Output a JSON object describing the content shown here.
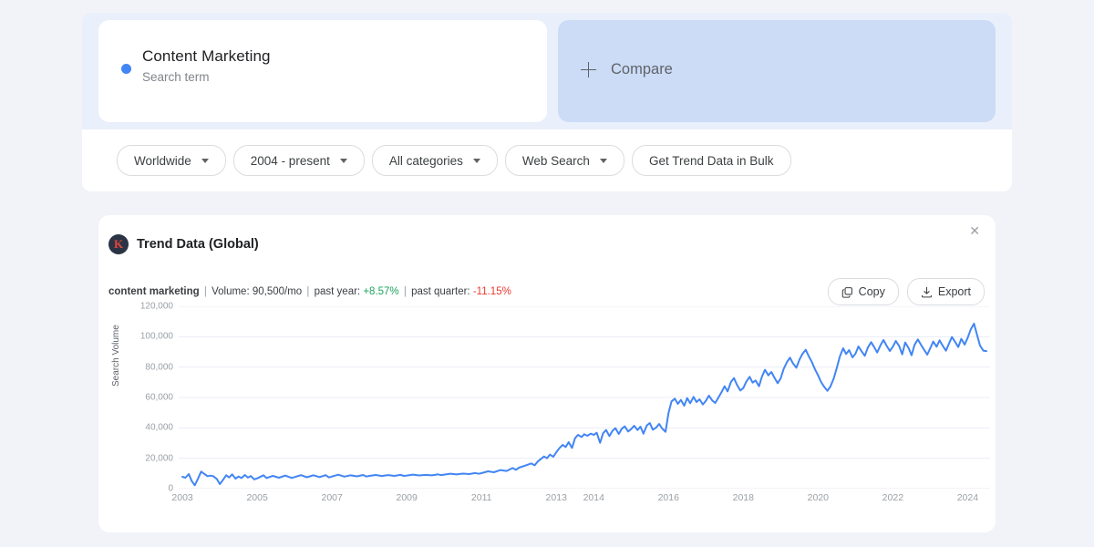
{
  "page": {
    "background_color": "#f1f3f8",
    "accent_color": "#4285f4"
  },
  "tab_strip": {
    "active_indicator_color": "#5a8df0"
  },
  "search_term_card": {
    "dot_color": "#4285f4",
    "title": "Content Marketing",
    "subtitle": "Search term"
  },
  "compare_card": {
    "icon": "plus-icon",
    "label": "Compare",
    "background_color": "#ccdcf6"
  },
  "filters": {
    "items": [
      {
        "label": "Worldwide",
        "has_caret": true
      },
      {
        "label": "2004 - present",
        "has_caret": true
      },
      {
        "label": "All categories",
        "has_caret": true
      },
      {
        "label": "Web Search",
        "has_caret": true
      },
      {
        "label": "Get Trend Data in Bulk",
        "has_caret": false
      }
    ]
  },
  "trend_card": {
    "logo_letter": "K",
    "logo_bg": "#2b3445",
    "logo_fg": "#e2453c",
    "title": "Trend Data (Global)",
    "close_icon": "✕",
    "stats": {
      "keyword": "content marketing",
      "volume_label": "Volume:",
      "volume_value": "90,500/mo",
      "past_year_label": "past year:",
      "past_year_value": "+8.57%",
      "past_year_color": "#1ea35f",
      "past_quarter_label": "past quarter:",
      "past_quarter_value": "-11.15%",
      "past_quarter_color": "#e8392f",
      "separator": "|"
    },
    "actions": [
      {
        "label": "Copy",
        "icon": "copy-icon"
      },
      {
        "label": "Export",
        "icon": "download-icon"
      }
    ]
  },
  "chart_data": {
    "type": "line",
    "title": "",
    "xlabel": "",
    "ylabel": "Search Volume",
    "ylim": [
      0,
      120000
    ],
    "yticks": [
      0,
      20000,
      40000,
      60000,
      80000,
      100000,
      120000
    ],
    "ytick_labels": [
      "0",
      "20,000",
      "40,000",
      "60,000",
      "80,000",
      "100,000",
      "120,000"
    ],
    "xtick_labels": [
      "2003",
      "2005",
      "2007",
      "2009",
      "2011",
      "2013",
      "2014",
      "2016",
      "2018",
      "2020",
      "2022",
      "2024"
    ],
    "xtick_positions": [
      2003,
      2005,
      2007,
      2009,
      2011,
      2013,
      2014,
      2016,
      2018,
      2020,
      2022,
      2024
    ],
    "xlim": [
      2002.9,
      2024.6
    ],
    "grid": true,
    "legend": "none",
    "line_color": "#4285f4",
    "series": [
      {
        "name": "content marketing",
        "values": [
          [
            2003.0,
            7800
          ],
          [
            2003.08,
            7200
          ],
          [
            2003.17,
            9600
          ],
          [
            2003.25,
            5000
          ],
          [
            2003.33,
            2200
          ],
          [
            2003.42,
            6800
          ],
          [
            2003.5,
            11200
          ],
          [
            2003.58,
            9800
          ],
          [
            2003.67,
            8200
          ],
          [
            2003.75,
            8600
          ],
          [
            2003.83,
            8100
          ],
          [
            2003.92,
            6400
          ],
          [
            2004.0,
            3000
          ],
          [
            2004.08,
            5600
          ],
          [
            2004.17,
            8800
          ],
          [
            2004.25,
            7400
          ],
          [
            2004.33,
            9400
          ],
          [
            2004.42,
            6600
          ],
          [
            2004.5,
            8000
          ],
          [
            2004.58,
            7000
          ],
          [
            2004.67,
            9000
          ],
          [
            2004.75,
            7300
          ],
          [
            2004.83,
            8300
          ],
          [
            2004.92,
            6100
          ],
          [
            2005.0,
            6800
          ],
          [
            2005.17,
            8800
          ],
          [
            2005.25,
            7000
          ],
          [
            2005.42,
            8400
          ],
          [
            2005.58,
            7200
          ],
          [
            2005.75,
            8600
          ],
          [
            2005.92,
            7100
          ],
          [
            2006.0,
            7600
          ],
          [
            2006.17,
            8900
          ],
          [
            2006.33,
            7500
          ],
          [
            2006.5,
            8800
          ],
          [
            2006.67,
            7600
          ],
          [
            2006.83,
            8900
          ],
          [
            2006.92,
            7400
          ],
          [
            2007.0,
            8000
          ],
          [
            2007.17,
            9200
          ],
          [
            2007.33,
            7900
          ],
          [
            2007.5,
            8800
          ],
          [
            2007.67,
            8100
          ],
          [
            2007.83,
            9000
          ],
          [
            2007.92,
            8000
          ],
          [
            2008.0,
            8400
          ],
          [
            2008.17,
            9000
          ],
          [
            2008.33,
            8300
          ],
          [
            2008.5,
            8900
          ],
          [
            2008.67,
            8400
          ],
          [
            2008.83,
            9100
          ],
          [
            2008.92,
            8400
          ],
          [
            2009.0,
            8600
          ],
          [
            2009.17,
            9200
          ],
          [
            2009.33,
            8700
          ],
          [
            2009.5,
            9100
          ],
          [
            2009.67,
            8800
          ],
          [
            2009.83,
            9400
          ],
          [
            2009.92,
            8900
          ],
          [
            2010.0,
            9200
          ],
          [
            2010.17,
            9800
          ],
          [
            2010.33,
            9400
          ],
          [
            2010.5,
            9900
          ],
          [
            2010.67,
            9600
          ],
          [
            2010.83,
            10300
          ],
          [
            2010.92,
            9800
          ],
          [
            2011.0,
            10200
          ],
          [
            2011.17,
            11400
          ],
          [
            2011.33,
            10800
          ],
          [
            2011.5,
            12200
          ],
          [
            2011.67,
            11600
          ],
          [
            2011.83,
            13600
          ],
          [
            2011.92,
            12400
          ],
          [
            2012.0,
            13800
          ],
          [
            2012.17,
            15200
          ],
          [
            2012.33,
            16600
          ],
          [
            2012.42,
            15400
          ],
          [
            2012.5,
            17800
          ],
          [
            2012.58,
            19400
          ],
          [
            2012.67,
            21200
          ],
          [
            2012.75,
            20000
          ],
          [
            2012.83,
            22400
          ],
          [
            2012.92,
            21000
          ],
          [
            2013.0,
            24000
          ],
          [
            2013.08,
            26600
          ],
          [
            2013.17,
            28800
          ],
          [
            2013.25,
            27400
          ],
          [
            2013.33,
            30600
          ],
          [
            2013.42,
            26800
          ],
          [
            2013.5,
            33200
          ],
          [
            2013.58,
            35400
          ],
          [
            2013.67,
            34000
          ],
          [
            2013.75,
            35800
          ],
          [
            2013.83,
            34800
          ],
          [
            2013.92,
            36200
          ],
          [
            2014.0,
            35400
          ],
          [
            2014.08,
            36800
          ],
          [
            2014.17,
            30200
          ],
          [
            2014.25,
            36400
          ],
          [
            2014.33,
            38600
          ],
          [
            2014.42,
            34600
          ],
          [
            2014.5,
            38000
          ],
          [
            2014.58,
            39800
          ],
          [
            2014.67,
            36000
          ],
          [
            2014.75,
            39400
          ],
          [
            2014.83,
            41000
          ],
          [
            2014.92,
            37600
          ],
          [
            2015.0,
            39200
          ],
          [
            2015.08,
            41400
          ],
          [
            2015.17,
            38600
          ],
          [
            2015.25,
            40800
          ],
          [
            2015.33,
            36200
          ],
          [
            2015.42,
            41600
          ],
          [
            2015.5,
            43200
          ],
          [
            2015.58,
            38800
          ],
          [
            2015.67,
            40200
          ],
          [
            2015.75,
            42600
          ],
          [
            2015.83,
            39600
          ],
          [
            2015.92,
            37400
          ],
          [
            2016.0,
            49800
          ],
          [
            2016.08,
            57400
          ],
          [
            2016.17,
            59200
          ],
          [
            2016.25,
            55800
          ],
          [
            2016.33,
            58400
          ],
          [
            2016.42,
            54600
          ],
          [
            2016.5,
            59600
          ],
          [
            2016.58,
            56200
          ],
          [
            2016.67,
            60400
          ],
          [
            2016.75,
            57000
          ],
          [
            2016.83,
            58800
          ],
          [
            2016.92,
            55400
          ],
          [
            2017.0,
            57800
          ],
          [
            2017.08,
            61200
          ],
          [
            2017.17,
            58000
          ],
          [
            2017.25,
            56400
          ],
          [
            2017.33,
            59800
          ],
          [
            2017.42,
            63600
          ],
          [
            2017.5,
            67400
          ],
          [
            2017.58,
            64000
          ],
          [
            2017.67,
            70200
          ],
          [
            2017.75,
            72800
          ],
          [
            2017.83,
            68400
          ],
          [
            2017.92,
            64600
          ],
          [
            2018.0,
            66200
          ],
          [
            2018.08,
            70400
          ],
          [
            2018.17,
            73600
          ],
          [
            2018.25,
            69800
          ],
          [
            2018.33,
            71200
          ],
          [
            2018.42,
            67400
          ],
          [
            2018.5,
            73800
          ],
          [
            2018.58,
            78200
          ],
          [
            2018.67,
            74600
          ],
          [
            2018.75,
            76800
          ],
          [
            2018.83,
            73200
          ],
          [
            2018.92,
            69400
          ],
          [
            2019.0,
            72600
          ],
          [
            2019.08,
            78800
          ],
          [
            2019.17,
            83400
          ],
          [
            2019.25,
            86200
          ],
          [
            2019.33,
            82400
          ],
          [
            2019.42,
            79600
          ],
          [
            2019.5,
            84800
          ],
          [
            2019.58,
            88600
          ],
          [
            2019.67,
            91400
          ],
          [
            2019.75,
            87200
          ],
          [
            2019.83,
            83600
          ],
          [
            2019.92,
            78400
          ],
          [
            2020.0,
            74600
          ],
          [
            2020.08,
            70200
          ],
          [
            2020.17,
            66800
          ],
          [
            2020.25,
            64400
          ],
          [
            2020.33,
            67200
          ],
          [
            2020.42,
            72600
          ],
          [
            2020.5,
            79400
          ],
          [
            2020.58,
            86800
          ],
          [
            2020.67,
            92400
          ],
          [
            2020.75,
            88600
          ],
          [
            2020.83,
            91200
          ],
          [
            2020.92,
            86400
          ],
          [
            2021.0,
            88800
          ],
          [
            2021.08,
            93600
          ],
          [
            2021.17,
            90200
          ],
          [
            2021.25,
            87400
          ],
          [
            2021.33,
            92800
          ],
          [
            2021.42,
            96400
          ],
          [
            2021.5,
            93200
          ],
          [
            2021.58,
            89600
          ],
          [
            2021.67,
            94400
          ],
          [
            2021.75,
            97800
          ],
          [
            2021.83,
            94200
          ],
          [
            2021.92,
            90600
          ],
          [
            2022.0,
            93400
          ],
          [
            2022.08,
            97200
          ],
          [
            2022.17,
            93800
          ],
          [
            2022.25,
            88400
          ],
          [
            2022.33,
            96200
          ],
          [
            2022.42,
            92600
          ],
          [
            2022.5,
            87800
          ],
          [
            2022.58,
            94600
          ],
          [
            2022.67,
            98200
          ],
          [
            2022.75,
            94800
          ],
          [
            2022.83,
            91600
          ],
          [
            2022.92,
            88200
          ],
          [
            2023.0,
            92400
          ],
          [
            2023.08,
            96800
          ],
          [
            2023.17,
            93400
          ],
          [
            2023.25,
            97600
          ],
          [
            2023.33,
            94200
          ],
          [
            2023.42,
            90800
          ],
          [
            2023.5,
            95400
          ],
          [
            2023.58,
            99800
          ],
          [
            2023.67,
            96400
          ],
          [
            2023.75,
            93200
          ],
          [
            2023.83,
            98600
          ],
          [
            2023.92,
            94800
          ],
          [
            2024.0,
            99200
          ],
          [
            2024.08,
            104600
          ],
          [
            2024.17,
            108600
          ],
          [
            2024.25,
            101400
          ],
          [
            2024.33,
            94200
          ],
          [
            2024.42,
            90800
          ],
          [
            2024.5,
            90500
          ]
        ]
      }
    ]
  }
}
